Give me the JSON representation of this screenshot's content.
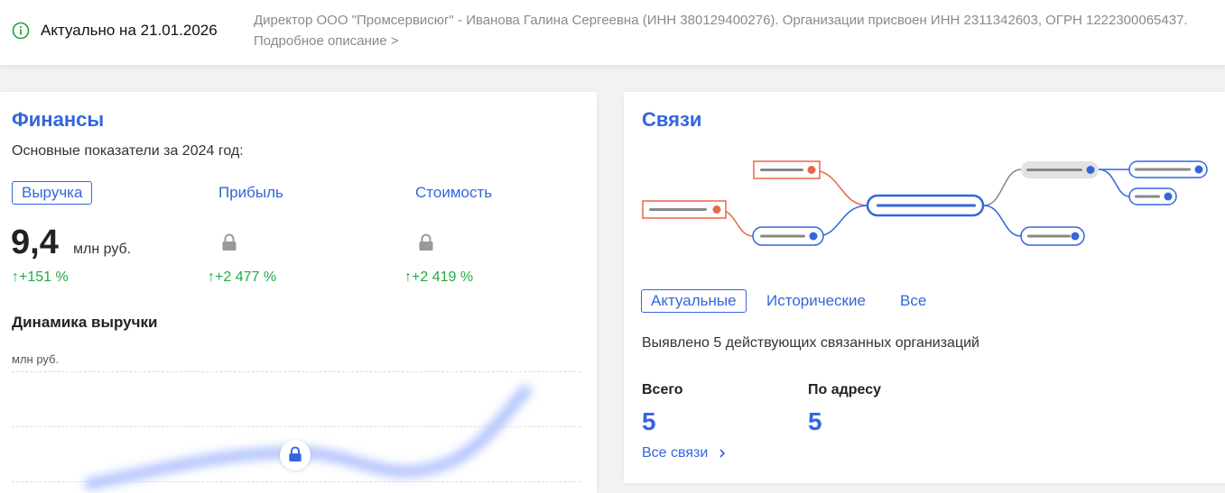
{
  "topbar": {
    "status": "Актуально на 21.01.2026",
    "description": "Директор ООО \"Промсервисюг\" - Иванова Галина Сергеевна (ИНН 380129400276). Организации присвоен ИНН 2311342603, ОГРН 1222300065437. Подробное описание >"
  },
  "finance": {
    "title": "Финансы",
    "subtitle": "Основные показатели за 2024 год:",
    "metrics": [
      {
        "label": "Выручка",
        "value": "9,4",
        "unit": "млн руб.",
        "growth": "↑+151 %",
        "locked": false
      },
      {
        "label": "Прибыль",
        "growth": "↑+2 477 %",
        "locked": true
      },
      {
        "label": "Стоимость",
        "growth": "↑+2 419 %",
        "locked": true
      }
    ],
    "chart_title": "Динамика выручки",
    "chart_unit": "млн руб."
  },
  "links": {
    "title": "Связи",
    "tabs": [
      "Актуальные",
      "Исторические",
      "Все"
    ],
    "found_text": "Выявлено 5 действующих связанных организаций",
    "total_label": "Всего",
    "total_value": "5",
    "address_label": "По адресу",
    "address_value": "5",
    "all_links": "Все связи"
  },
  "colors": {
    "accent": "#3366dd",
    "growth": "#22aa44",
    "related_red": "#e8664a"
  }
}
